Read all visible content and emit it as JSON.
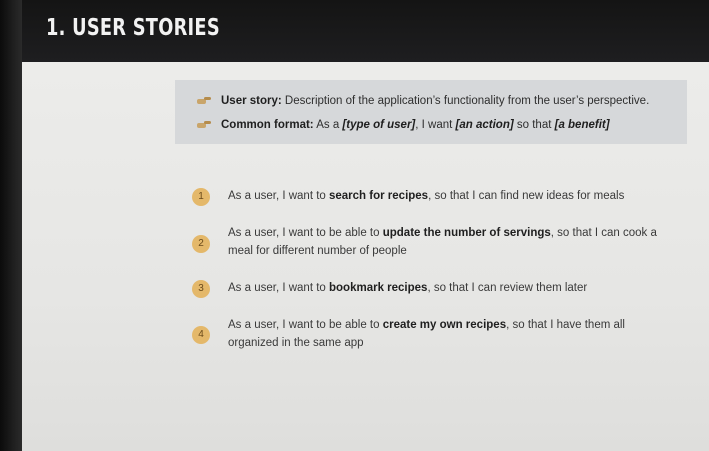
{
  "slide": {
    "title": "1. USER STORIES"
  },
  "info": {
    "row1": {
      "label": "User story:",
      "text": " Description of the application’s functionality from the user’s perspective."
    },
    "row2": {
      "label": "Common format:",
      "t1": " As a ",
      "i1": "[type of user]",
      "t2": ", I want ",
      "i2": "[an action]",
      "t3": " so that ",
      "i3": "[a benefit]"
    }
  },
  "stories": [
    {
      "number": "1",
      "pre": "As a user, I want to ",
      "bold": "search for recipes",
      "post": ", so that I can find new ideas for meals"
    },
    {
      "number": "2",
      "pre": "As a user, I want to be able to ",
      "bold": "update the number of servings",
      "post": ", so that I can cook a meal for different number of people"
    },
    {
      "number": "3",
      "pre": "As a user, I want to ",
      "bold": "bookmark recipes",
      "post": ", so that I can review them later"
    },
    {
      "number": "4",
      "pre": "As a user, I want to be able to ",
      "bold": "create my own recipes",
      "post": ", so that I have them all organized in the same app"
    }
  ],
  "icons": {
    "bullet": "pointing-hand-icon"
  }
}
